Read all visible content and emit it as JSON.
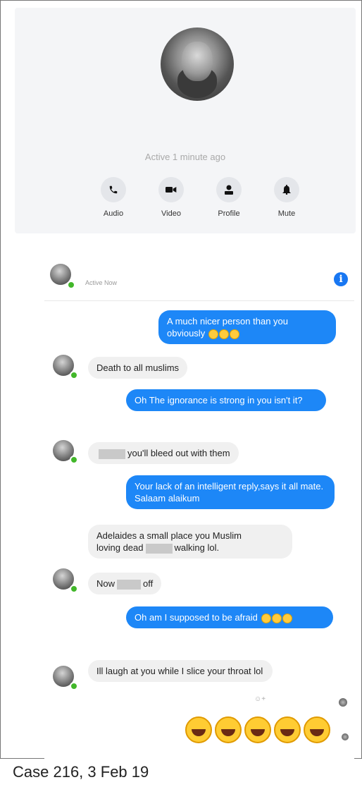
{
  "profile": {
    "status": "Active 1 minute ago",
    "actions": [
      {
        "label": "Audio",
        "icon": "phone-icon"
      },
      {
        "label": "Video",
        "icon": "video-camera-icon"
      },
      {
        "label": "Profile",
        "icon": "person-icon"
      },
      {
        "label": "Mute",
        "icon": "bell-icon"
      }
    ]
  },
  "chat_header": {
    "status": "Active Now",
    "info_glyph": "i"
  },
  "messages": [
    {
      "side": "out",
      "text": "A much nicer person than you obviously",
      "emojis": 3
    },
    {
      "side": "in",
      "text": "Death to all muslims"
    },
    {
      "side": "out",
      "text": "Oh The ignorance is strong in you isn't it?"
    },
    {
      "side": "in",
      "text_after_redaction": "you'll bleed out with them"
    },
    {
      "side": "out",
      "text": "Your lack of an intelligent reply,says it all mate. Salaam alaikum"
    },
    {
      "side": "in",
      "text_line1": "Adelaides a small place you Muslim",
      "text_line2_before": "loving dead",
      "text_line2_after": "walking lol."
    },
    {
      "side": "in",
      "text_before": "Now",
      "text_after": "off"
    },
    {
      "side": "out",
      "text": "Oh am I supposed to be afraid",
      "emojis": 3
    },
    {
      "side": "in",
      "text": "Ill laugh at you while I slice your throat lol"
    }
  ],
  "final_reaction": {
    "emoji": "laughing-crying-emoji",
    "count": 5
  },
  "colors": {
    "outgoing": "#1d87f7",
    "incoming": "#f0f0f0",
    "online": "#42b72a",
    "accent": "#1877f2"
  },
  "caption": "Case 216, 3 Feb 19"
}
